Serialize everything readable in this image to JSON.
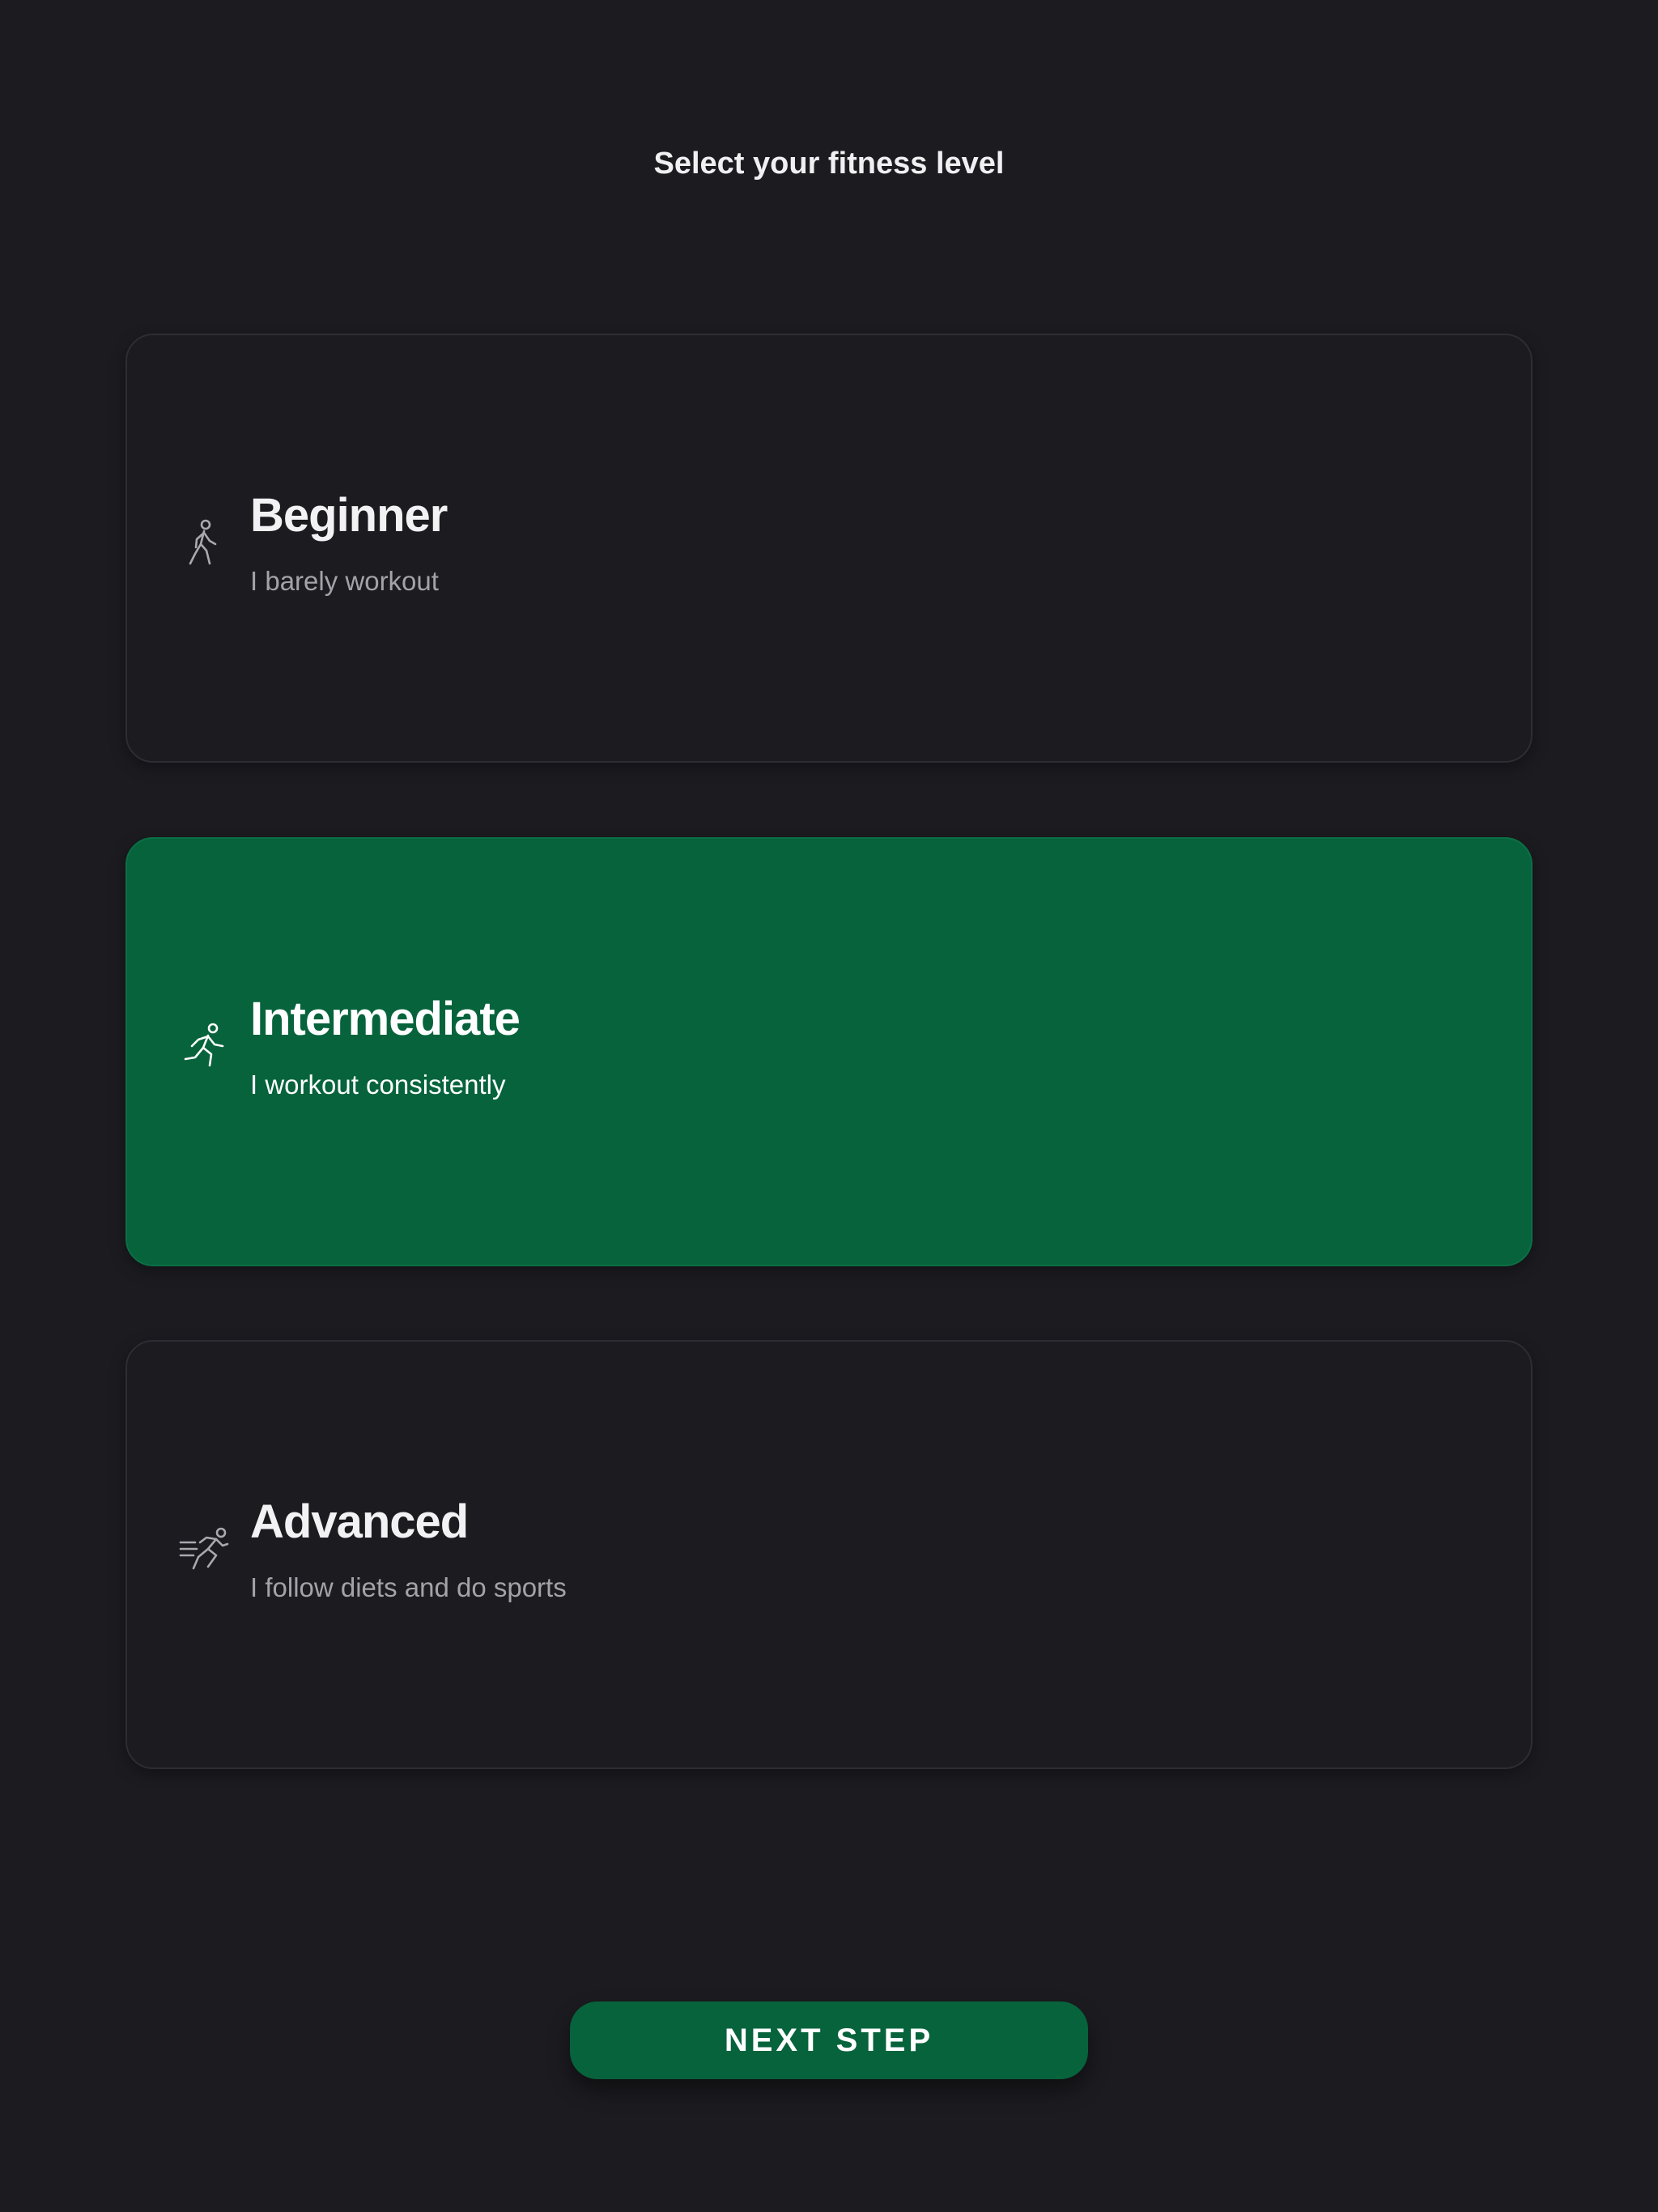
{
  "header": {
    "title": "Select your fitness level"
  },
  "levels": [
    {
      "title": "Beginner",
      "subtitle": "I barely workout",
      "icon": "walking-person-icon",
      "selected": false
    },
    {
      "title": "Intermediate",
      "subtitle": "I workout consistently",
      "icon": "running-person-icon",
      "selected": true
    },
    {
      "title": "Advanced",
      "subtitle": "I follow diets and do sports",
      "icon": "sprinting-person-icon",
      "selected": false
    }
  ],
  "footer": {
    "next_label": "NEXT STEP"
  },
  "colors": {
    "background": "#1c1b20",
    "accent": "#06633c",
    "card_border": "#2e2d33",
    "subtitle_text": "#a3a3a8"
  }
}
